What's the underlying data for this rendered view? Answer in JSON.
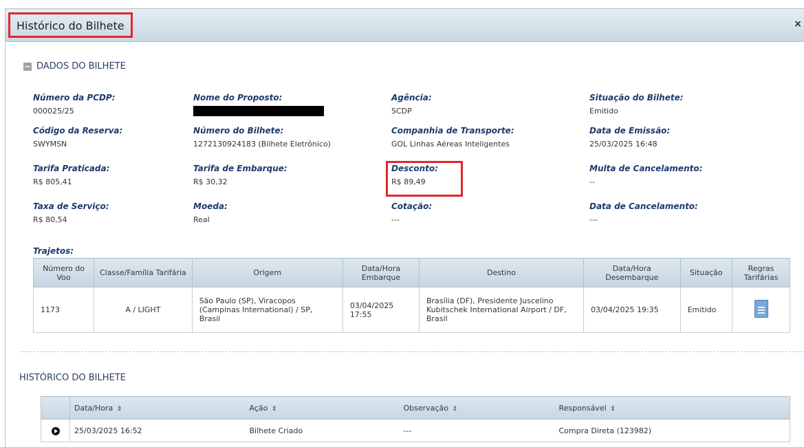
{
  "dialog": {
    "title": "Histórico do Bilhete",
    "close_glyph": "×",
    "section_title": "DADOS DO BILHETE",
    "toggle_glyph": "−",
    "highlight_color": "#e2262b"
  },
  "fields": {
    "numero_pcdp": {
      "label": "Número da PCDP:",
      "value": "000025/25"
    },
    "nome_proposto": {
      "label": "Nome do Proposto:",
      "value": ""
    },
    "agencia": {
      "label": "Agência:",
      "value": "SCDP"
    },
    "situacao_bilhete": {
      "label": "Situação do Bilhete:",
      "value": "Emitido"
    },
    "codigo_reserva": {
      "label": "Código da Reserva:",
      "value": "SWYMSN"
    },
    "numero_bilhete": {
      "label": "Número do Bilhete:",
      "value": "1272130924183 (Bilhete Eletrônico)"
    },
    "companhia": {
      "label": "Companhia de Transporte:",
      "value": "GOL Linhas Aéreas Inteligentes"
    },
    "data_emissao": {
      "label": "Data de Emissão:",
      "value": "25/03/2025 16:48"
    },
    "tarifa_praticada": {
      "label": "Tarifa Praticada:",
      "value": "R$ 805,41"
    },
    "tarifa_embarque": {
      "label": "Tarifa de Embarque:",
      "value": "R$ 30,32"
    },
    "desconto": {
      "label": "Desconto:",
      "value": "R$ 89,49"
    },
    "multa_cancelamento": {
      "label": "Multa de Cancelamento:",
      "value": "--"
    },
    "taxa_servico": {
      "label": "Taxa de Serviço:",
      "value": "R$ 80,54"
    },
    "moeda": {
      "label": "Moeda:",
      "value": "Real"
    },
    "cotacao": {
      "label": "Cotação:",
      "value": "---"
    },
    "data_cancelamento": {
      "label": "Data de Cancelamento:",
      "value": "---"
    }
  },
  "trajetos": {
    "label": "Trajetos:",
    "headers": {
      "voo": "Número do Voo",
      "classe": "Classe/Família Tarifária",
      "origem": "Origem",
      "embarque": "Data/Hora Embarque",
      "destino": "Destino",
      "desembarque": "Data/Hora Desembarque",
      "situacao": "Situação",
      "regras": "Regras Tarifárias"
    },
    "row": {
      "voo": "1173",
      "classe": "A / LIGHT",
      "origem": "São Paulo (SP), Viracopos (Campinas International) / SP, Brasil",
      "embarque": "03/04/2025 17:55",
      "destino": "Brasília (DF), Presidente Juscelino Kubitschek International Airport / DF, Brasil",
      "desembarque": "03/04/2025 19:35",
      "situacao": "Emitido",
      "regras_icon": "document-icon"
    }
  },
  "historico": {
    "title": "HISTÓRICO DO BILHETE",
    "sort_glyph": "⇕",
    "headers": {
      "datahora": "Data/Hora",
      "acao": "Ação",
      "observacao": "Observação",
      "responsavel": "Responsável"
    },
    "row": {
      "datahora": "25/03/2025 16:52",
      "acao": "Bilhete Criado",
      "observacao": "---",
      "responsavel": "Compra Direta (123982)"
    }
  }
}
